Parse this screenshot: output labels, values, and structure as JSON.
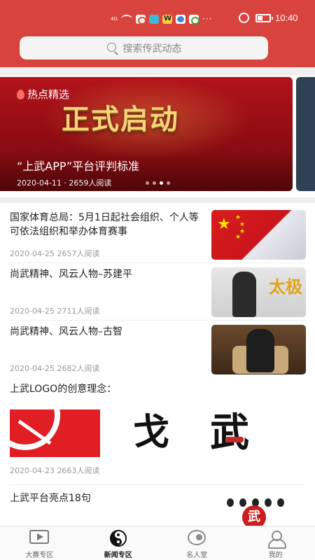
{
  "status_bar": {
    "network": "4G",
    "time": "10:40",
    "battery_level": 0.45,
    "icons": [
      "signal-icon",
      "wifi-icon",
      "app-notification-icon",
      "weibo-icon",
      "message-icon",
      "more-dots-icon",
      "alarm-icon",
      "battery-icon"
    ]
  },
  "search": {
    "placeholder": "搜索传武动态"
  },
  "banner": {
    "tag": "热点精选",
    "headline": "正式启动",
    "title": "“上武APP”平台评判标准",
    "meta": "2020-04-11 · 2659人阅读",
    "slide_count": 4,
    "active_slide": 3
  },
  "news": [
    {
      "title": "国家体育总局：5月1日起社会组织、个人等可依法组织和举办体育赛事",
      "date": "2020-04-25",
      "reads": "2657人阅读",
      "thumb": "flag-image"
    },
    {
      "title": "尚武精神、风云人物–苏建平",
      "date": "2020-04-25",
      "reads": "2711人阅读",
      "thumb": "martial-artist-image",
      "thumb_text": "太极"
    },
    {
      "title": "尚武精神、风云人物–古智",
      "date": "2020-04-25",
      "reads": "2682人阅读",
      "thumb": "portrait-image"
    },
    {
      "title": "上武LOGO的创意理念：",
      "date": "2020-04-23",
      "reads": "2663人阅读",
      "logo_chars": [
        "戈",
        "武"
      ]
    },
    {
      "title": "上武平台亮点18句",
      "thumb_text": "武"
    }
  ],
  "tabs": [
    {
      "label": "大赛专区",
      "icon": "play-icon",
      "active": false
    },
    {
      "label": "新闻专区",
      "icon": "yin-yang-icon",
      "active": true
    },
    {
      "label": "名人堂",
      "icon": "hall-of-fame-icon",
      "active": false
    },
    {
      "label": "我的",
      "icon": "profile-icon",
      "active": false
    }
  ],
  "colors": {
    "primary": "#d9433e",
    "banner": "#b3141b",
    "active_tab": "#222222",
    "meta_text": "#999999"
  }
}
